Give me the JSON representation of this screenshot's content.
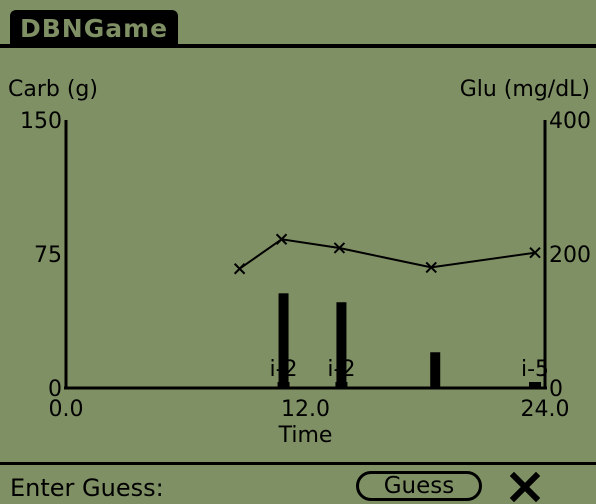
{
  "app": {
    "title": "DBNGame"
  },
  "chart_data": {
    "type": "bar",
    "left_axis": {
      "label": "Carb (g)",
      "ticks": [
        "150",
        "75",
        "0"
      ],
      "ylim": [
        0,
        150
      ]
    },
    "right_axis": {
      "label": "Glu (mg/dL)",
      "ticks": [
        "400",
        "200",
        "0"
      ],
      "ylim": [
        0,
        400
      ]
    },
    "x_axis": {
      "label": "Time",
      "ticks": [
        "0.0",
        "12.0",
        "24.0"
      ],
      "xlim": [
        0,
        24
      ]
    },
    "glucose_series": {
      "marker": "x",
      "points": [
        {
          "x": 8.7,
          "y": 178
        },
        {
          "x": 10.8,
          "y": 222
        },
        {
          "x": 13.7,
          "y": 209
        },
        {
          "x": 18.3,
          "y": 180
        },
        {
          "x": 23.5,
          "y": 202
        }
      ]
    },
    "carb_bars": [
      {
        "x": 10.9,
        "y": 53
      },
      {
        "x": 13.8,
        "y": 48
      },
      {
        "x": 18.5,
        "y": 20
      }
    ],
    "insulin_markers": [
      {
        "x": 10.9,
        "label": "i-2"
      },
      {
        "x": 13.8,
        "label": "i-2"
      },
      {
        "x": 23.5,
        "label": "i-5"
      }
    ]
  },
  "footer": {
    "guess_label": "Enter Guess:",
    "guess_value": "",
    "guess_button": "Guess",
    "close_icon": "close-icon"
  }
}
